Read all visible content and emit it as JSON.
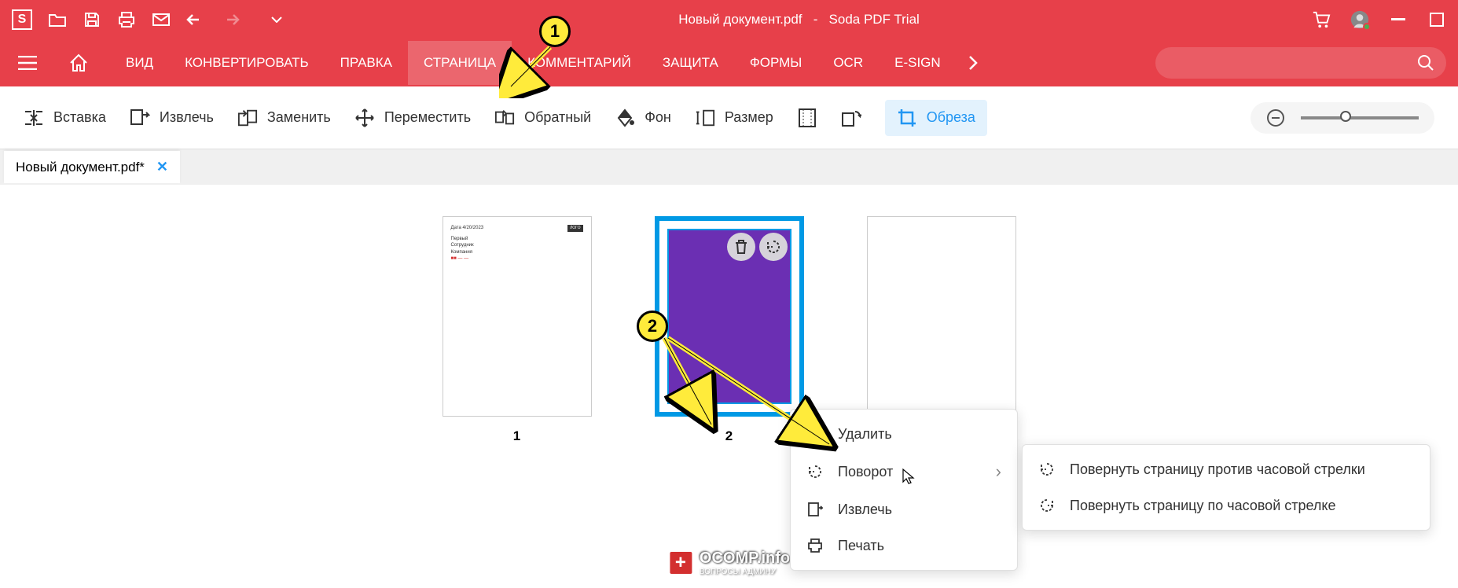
{
  "titlebar": {
    "doc_name": "Новый документ.pdf",
    "separator": "-",
    "app_name": "Soda PDF Trial"
  },
  "menu": {
    "items": [
      "ВИД",
      "КОНВЕРТИРОВАТЬ",
      "ПРАВКА",
      "СТРАНИЦА",
      "КОММЕНТАРИЙ",
      "ЗАЩИТА",
      "ФОРМЫ",
      "OCR",
      "E-SIGN"
    ],
    "active_index": 3
  },
  "toolbar": {
    "insert": "Вставка",
    "extract": "Извлечь",
    "replace": "Заменить",
    "move": "Переместить",
    "reverse": "Обратный",
    "background": "Фон",
    "size": "Размер",
    "crop": "Обреза"
  },
  "tab": {
    "name": "Новый документ.pdf*"
  },
  "pages": {
    "p1": "1",
    "p2": "2"
  },
  "context_menu": {
    "delete": "Удалить",
    "rotate": "Поворот",
    "extract": "Извлечь",
    "print": "Печать"
  },
  "submenu": {
    "ccw": "Повернуть страницу против часовой стрелки",
    "cw": "Повернуть страницу по часовой стрелке"
  },
  "callouts": {
    "c1": "1",
    "c2": "2"
  },
  "watermark": {
    "main": "OCOMP.info",
    "sub": "ВОПРОСЫ АДМИНУ"
  }
}
